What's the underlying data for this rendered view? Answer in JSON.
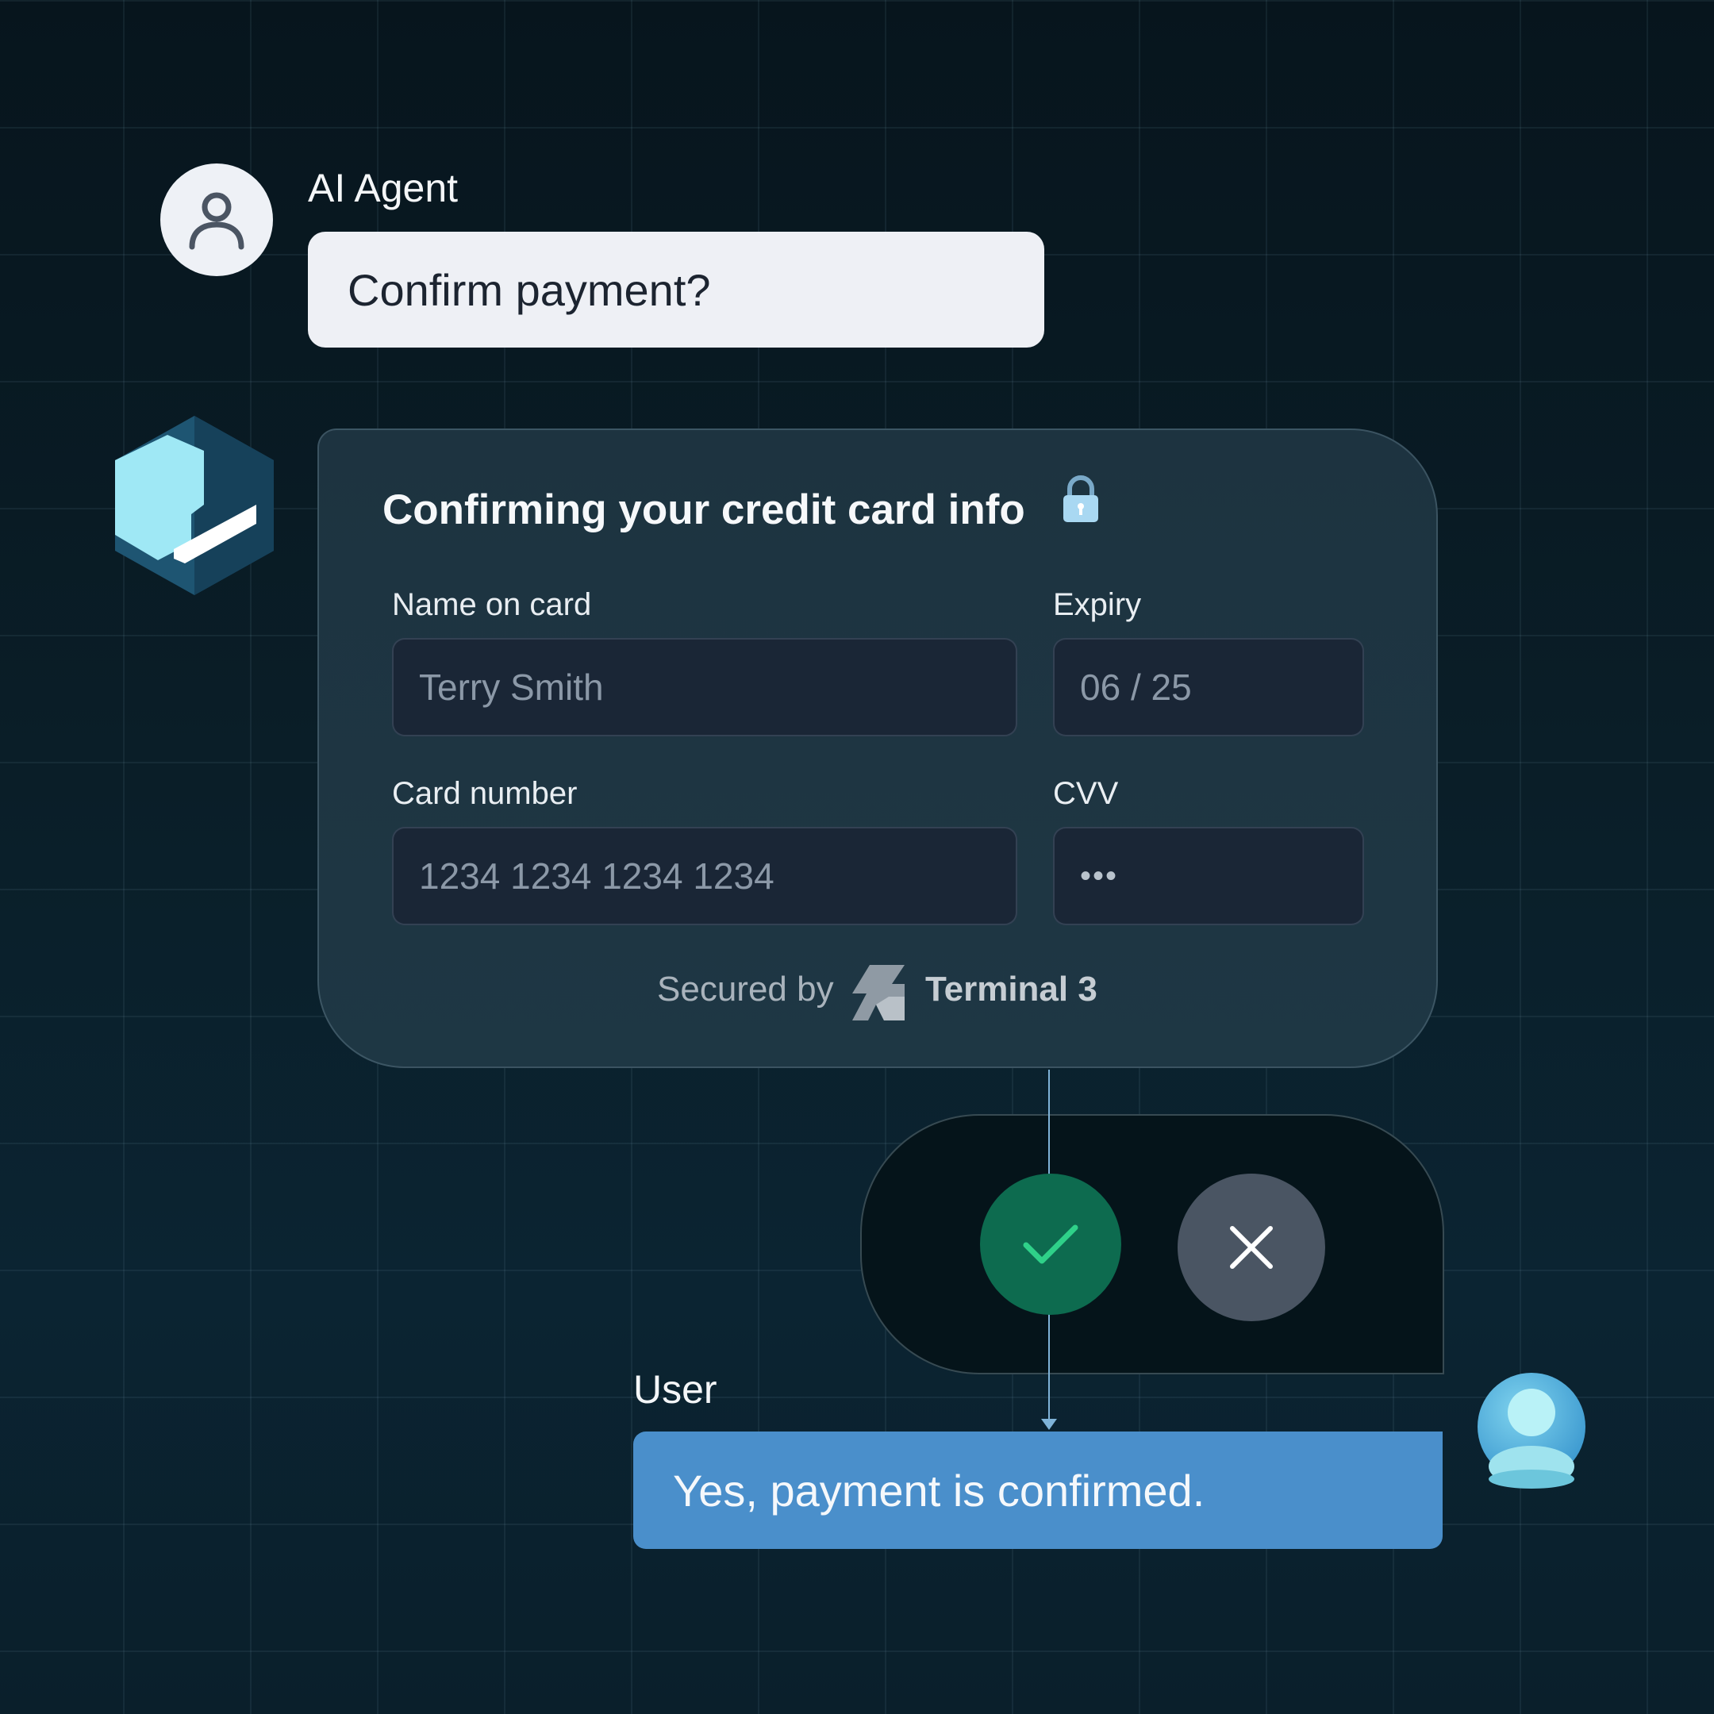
{
  "agent": {
    "name": "AI Agent",
    "message": "Confirm payment?",
    "avatar_icon": "user-outline-icon"
  },
  "form": {
    "title": "Confirming your credit card info",
    "lock_icon": "lock-icon",
    "name_label": "Name on card",
    "name_value": "Terry Smith",
    "expiry_label": "Expiry",
    "expiry_value": "06 / 25",
    "card_label": "Card number",
    "card_value": "1234 1234 1234 1234",
    "cvv_label": "CVV",
    "cvv_value": "•••",
    "secured_label": "Secured by",
    "brand_name": "Terminal 3"
  },
  "actions": {
    "confirm_icon": "checkmark-icon",
    "cancel_icon": "close-icon",
    "confirm_color": "#0d6b4f",
    "cancel_color": "#4a5563"
  },
  "user": {
    "name": "User",
    "message": "Yes, payment is confirmed.",
    "bubble_color": "#4a8fcb"
  }
}
